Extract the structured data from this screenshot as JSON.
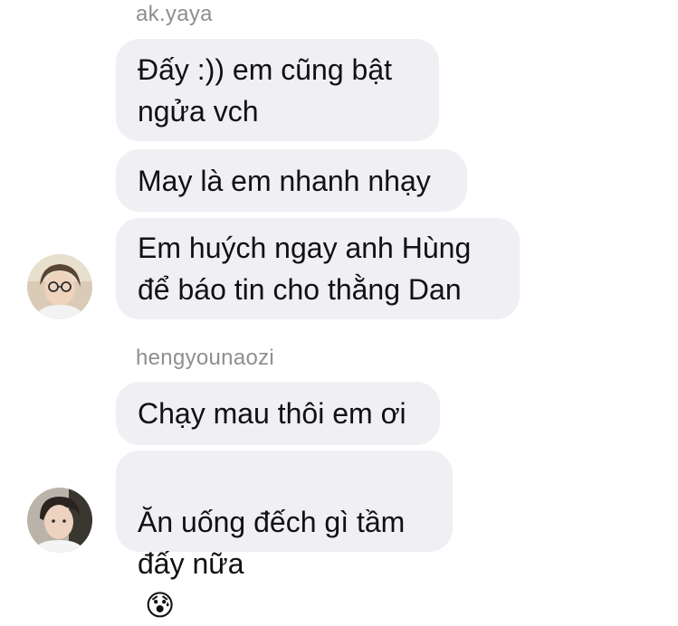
{
  "groups": [
    {
      "sender": "ak.yaya",
      "messages": [
        "Đấy :)) em cũng bật\nngửa vch",
        "May là em nhanh nhạy",
        "Em huých ngay anh Hùng\nđể báo tin cho thằng Dan"
      ]
    },
    {
      "sender": "hengyounaozi",
      "messages": [
        "Chạy mau thôi em ơi",
        "Ăn uống đếch gì tầm\nđấy nữa"
      ],
      "emoji": "😰"
    }
  ],
  "icons": {
    "avatar_1": "user-avatar-glasses",
    "avatar_2": "user-avatar"
  }
}
